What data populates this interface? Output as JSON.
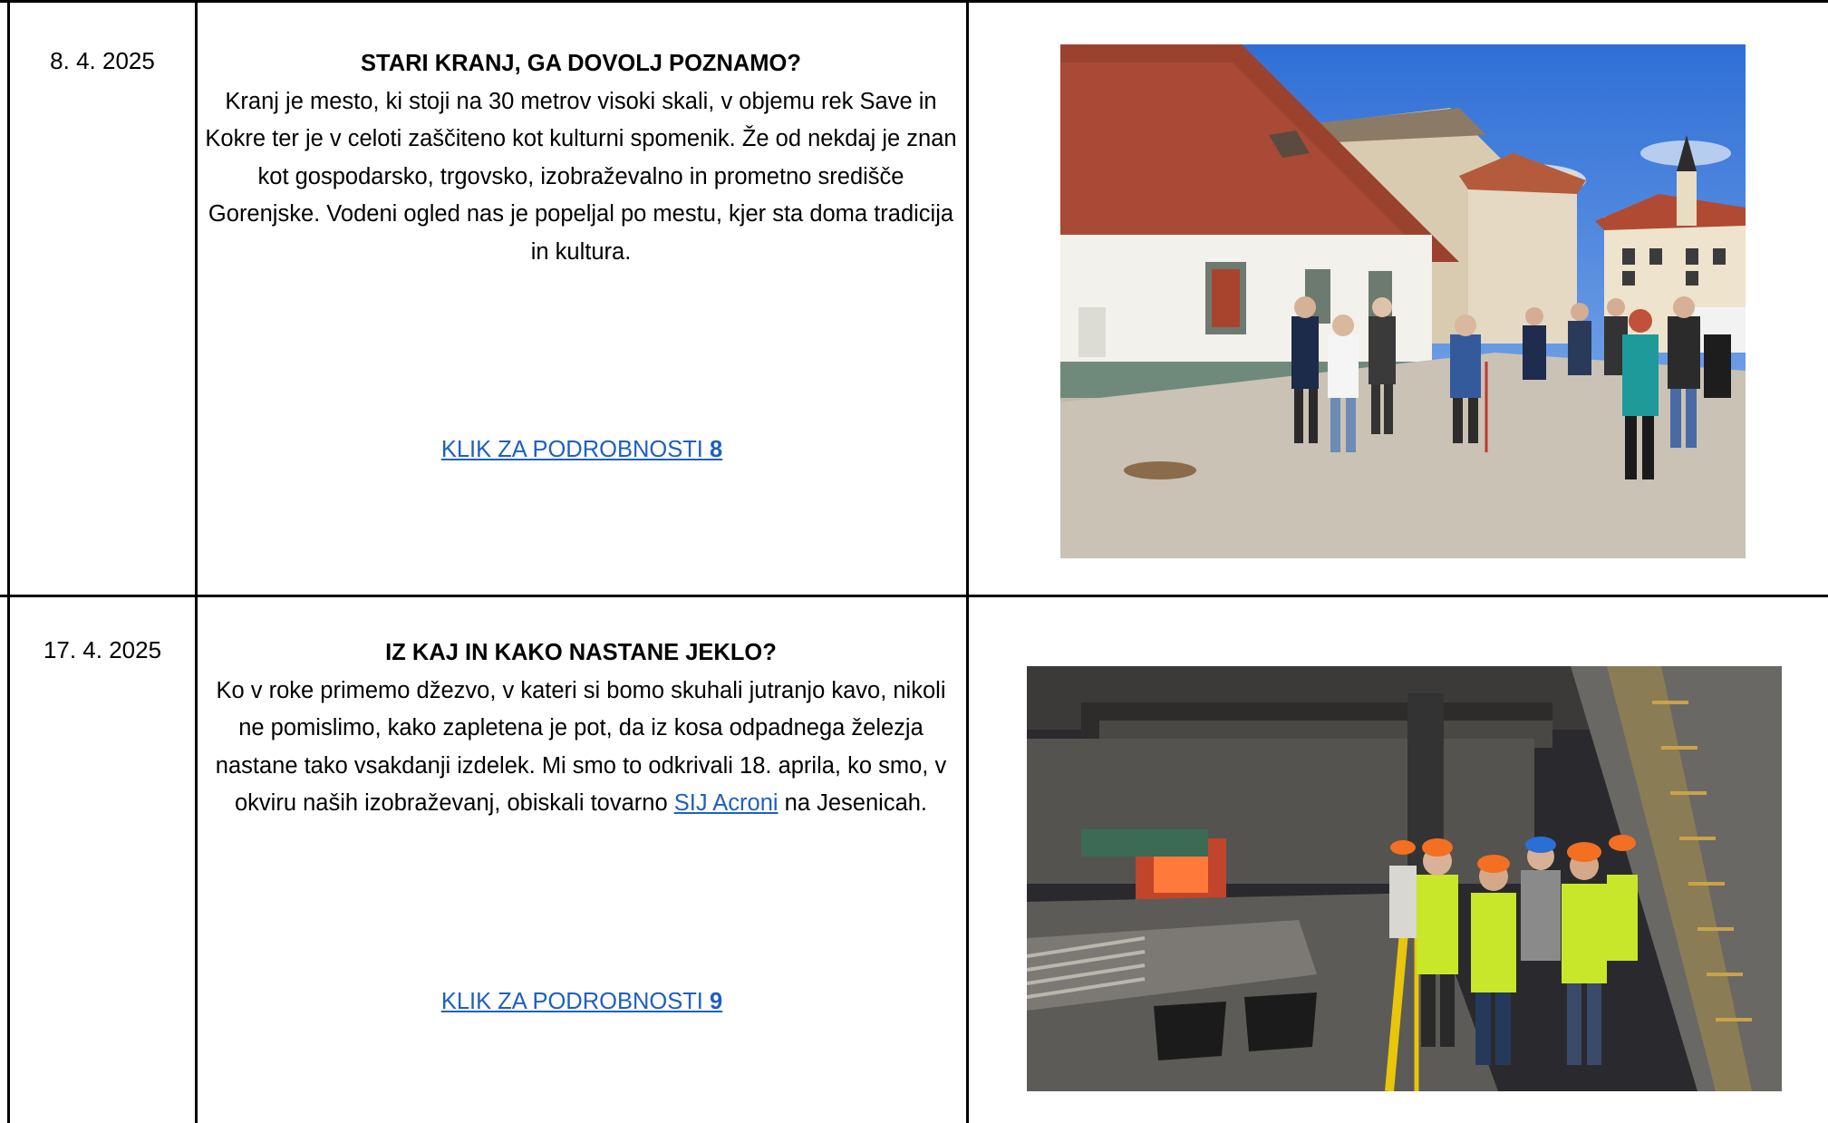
{
  "rows": [
    {
      "date": "8. 4. 2025",
      "title": "STARI KRANJ, GA DOVOLJ POZNAMO?",
      "description": "Kranj je mesto, ki stoji na 30 metrov visoki skali, v objemu rek Save in Kokre ter je v celoti zaščiteno kot kulturni spomenik. Že od nekdaj je znan kot gospodarsko, trgovsko, izobraževalno in prometno središče Gorenjske. Vodeni ogled nas je popeljal po mestu, kjer sta doma tradicija in kultura.",
      "more_label": "KLIK ZA PODROBNOSTI",
      "more_number": "8"
    },
    {
      "date": "17. 4. 2025",
      "title": "IZ KAJ IN KAKO NASTANE JEKLO?",
      "description_before": "Ko v roke primemo džezvo, v kateri si bomo skuhali jutranjo kavo, nikoli ne pomislimo, kako zapletena je pot, da iz kosa odpadnega železja nastane tako vsakdanji izdelek. Mi smo to odkrivali 18. aprila, ko smo, v okviru naših izobraževanj, obiskali tovarno",
      "description_link": "SIJ Acroni",
      "description_after": "na Jesenicah.",
      "more_label": "KLIK ZA PODROBNOSTI",
      "more_number": "9"
    }
  ],
  "colors": {
    "link": "#1f5fbf",
    "border": "#000000"
  }
}
